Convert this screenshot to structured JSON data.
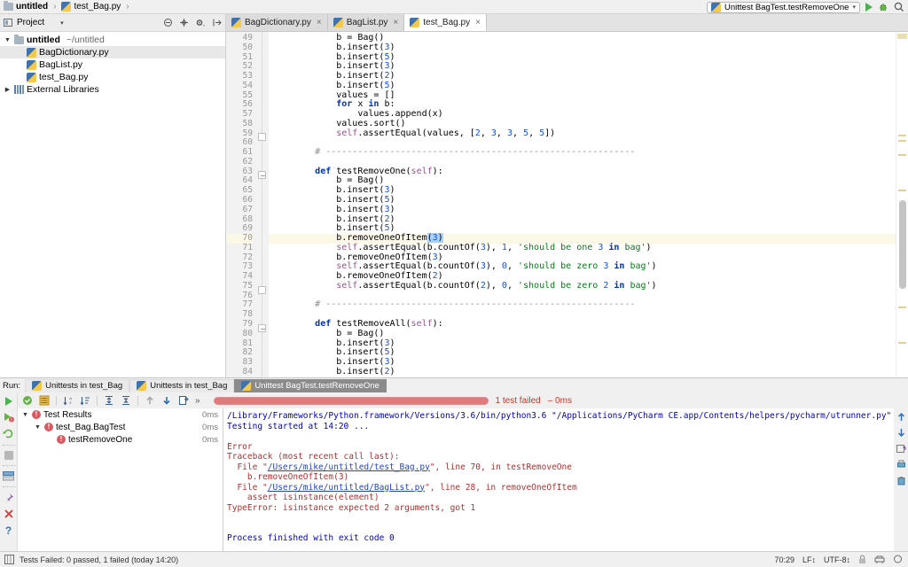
{
  "navbar": {
    "breadcrumb": [
      {
        "label": "untitled",
        "icon": "folder-icon",
        "bold": true
      },
      {
        "label": "test_Bag.py",
        "icon": "python-file-icon",
        "bold": false
      }
    ],
    "separator": "›",
    "run_configuration": "Unittest BagTest.testRemoveOne",
    "run_caret": "▾",
    "run_button": "run-icon",
    "debug_button": "debug-icon",
    "search_button": "search-icon"
  },
  "project_pane": {
    "title": "Project",
    "caret": "▾",
    "tools": [
      "collapse-all-icon",
      "locate-icon",
      "gear-icon",
      "hide-icon"
    ],
    "tree": [
      {
        "indent": 0,
        "twisty": "▼",
        "icon": "folder-icon",
        "label": "untitled",
        "bold": true,
        "sub": "~/untitled",
        "selected": false
      },
      {
        "indent": 1,
        "twisty": "",
        "icon": "python-file-icon",
        "label": "BagDictionary.py",
        "bold": false,
        "sub": "",
        "selected": true
      },
      {
        "indent": 1,
        "twisty": "",
        "icon": "python-file-icon",
        "label": "BagList.py",
        "bold": false,
        "sub": "",
        "selected": false
      },
      {
        "indent": 1,
        "twisty": "",
        "icon": "python-file-icon",
        "label": "test_Bag.py",
        "bold": false,
        "sub": "",
        "selected": false
      },
      {
        "indent": 0,
        "twisty": "▶",
        "icon": "library-icon",
        "label": "External Libraries",
        "bold": false,
        "sub": "",
        "selected": false
      }
    ]
  },
  "editor": {
    "tabs": [
      {
        "label": "BagDictionary.py",
        "icon": "python-file-icon",
        "close": "×",
        "active": false
      },
      {
        "label": "BagList.py",
        "icon": "python-file-icon",
        "close": "×",
        "active": false
      },
      {
        "label": "test_Bag.py",
        "icon": "python-file-icon",
        "close": "×",
        "active": true
      }
    ],
    "first_line_number": 49,
    "highlighted_line": 70,
    "lines": [
      {
        "n": 49,
        "text": "            b = Bag()"
      },
      {
        "n": 50,
        "text": "            b.insert(3)"
      },
      {
        "n": 51,
        "text": "            b.insert(5)"
      },
      {
        "n": 52,
        "text": "            b.insert(3)"
      },
      {
        "n": 53,
        "text": "            b.insert(2)"
      },
      {
        "n": 54,
        "text": "            b.insert(5)"
      },
      {
        "n": 55,
        "text": "            values = []"
      },
      {
        "n": 56,
        "text": "            for x in b:"
      },
      {
        "n": 57,
        "text": "                values.append(x)"
      },
      {
        "n": 58,
        "text": "            values.sort()"
      },
      {
        "n": 59,
        "text": "            self.assertEqual(values, [2, 3, 3, 5, 5])"
      },
      {
        "n": 60,
        "text": ""
      },
      {
        "n": 61,
        "text": "        # ----------------------------------------------------------"
      },
      {
        "n": 62,
        "text": ""
      },
      {
        "n": 63,
        "text": "        def testRemoveOne(self):"
      },
      {
        "n": 64,
        "text": "            b = Bag()"
      },
      {
        "n": 65,
        "text": "            b.insert(3)"
      },
      {
        "n": 66,
        "text": "            b.insert(5)"
      },
      {
        "n": 67,
        "text": "            b.insert(3)"
      },
      {
        "n": 68,
        "text": "            b.insert(2)"
      },
      {
        "n": 69,
        "text": "            b.insert(5)"
      },
      {
        "n": 70,
        "text": "            b.removeOneOfItem(3)"
      },
      {
        "n": 71,
        "text": "            self.assertEqual(b.countOf(3), 1, 'should be one 3 in bag')"
      },
      {
        "n": 72,
        "text": "            b.removeOneOfItem(3)"
      },
      {
        "n": 73,
        "text": "            self.assertEqual(b.countOf(3), 0, 'should be zero 3 in bag')"
      },
      {
        "n": 74,
        "text": "            b.removeOneOfItem(2)"
      },
      {
        "n": 75,
        "text": "            self.assertEqual(b.countOf(2), 0, 'should be zero 2 in bag')"
      },
      {
        "n": 76,
        "text": ""
      },
      {
        "n": 77,
        "text": "        # ----------------------------------------------------------"
      },
      {
        "n": 78,
        "text": ""
      },
      {
        "n": 79,
        "text": "        def testRemoveAll(self):"
      },
      {
        "n": 80,
        "text": "            b = Bag()"
      },
      {
        "n": 81,
        "text": "            b.insert(3)"
      },
      {
        "n": 82,
        "text": "            b.insert(5)"
      },
      {
        "n": 83,
        "text": "            b.insert(3)"
      },
      {
        "n": 84,
        "text": "            b.insert(2)"
      }
    ]
  },
  "run_panel": {
    "run_label": "Run:",
    "tabs": [
      {
        "label": "Unittests in test_Bag",
        "active": false
      },
      {
        "label": "Unittests in test_Bag",
        "active": false
      },
      {
        "label": "Unittest BagTest.testRemoveOne",
        "active": true
      }
    ],
    "left_rail": [
      "run-icon",
      "rerun-failed-icon",
      "rerun-icon",
      "stop-icon",
      "console-icon",
      "pin-icon",
      "close-icon",
      "help-icon"
    ],
    "toolbar": [
      "show-passed-icon",
      "expand-icon",
      "sort-alpha-icon",
      "sort-duration-icon",
      "expand-all-icon",
      "collapse-all-icon",
      "prev-icon",
      "next-icon",
      "export-icon",
      "more-icon"
    ],
    "toolbar_more": "»",
    "progress": {
      "status": "1 test failed",
      "duration": "– 0ms",
      "percent": 100,
      "color": "#c0392b"
    },
    "test_tree": [
      {
        "indent": 0,
        "twisty": "▼",
        "label": "Test Results",
        "time": "0ms"
      },
      {
        "indent": 1,
        "twisty": "▼",
        "label": "test_Bag.BagTest",
        "time": "0ms"
      },
      {
        "indent": 2,
        "twisty": "",
        "label": "testRemoveOne",
        "time": "0ms"
      }
    ],
    "console": [
      {
        "text": "/Library/Frameworks/Python.framework/Versions/3.6/bin/python3.6 \"/Applications/PyCharm CE.app/Contents/helpers/pycharm/utrunner.py\" /Users/mike/untitled/te",
        "style": "info"
      },
      {
        "text": "Testing started at 14:20 ...",
        "style": "info"
      },
      {
        "text": "",
        "style": "info"
      },
      {
        "text": "Error",
        "style": "error"
      },
      {
        "text": "Traceback (most recent call last):",
        "style": "error"
      },
      {
        "text": "  File \"/Users/mike/untitled/test_Bag.py\", line 70, in testRemoveOne",
        "style": "error",
        "link": "/Users/mike/untitled/test_Bag.py"
      },
      {
        "text": "    b.removeOneOfItem(3)",
        "style": "error"
      },
      {
        "text": "  File \"/Users/mike/untitled/BagList.py\", line 28, in removeOneOfItem",
        "style": "error",
        "link": "/Users/mike/untitled/BagList.py"
      },
      {
        "text": "    assert isinstance(element)",
        "style": "error"
      },
      {
        "text": "TypeError: isinstance expected 2 arguments, got 1",
        "style": "error"
      },
      {
        "text": "",
        "style": "info"
      },
      {
        "text": "",
        "style": "info"
      },
      {
        "text": "Process finished with exit code 0",
        "style": "info"
      }
    ],
    "console_rail": [
      "scroll-up-icon",
      "scroll-down-icon",
      "soft-wrap-icon",
      "print-icon",
      "clear-all-icon"
    ]
  },
  "statusbar": {
    "icon": "event-log-icon",
    "message": "Tests Failed: 0 passed, 1 failed (today 14:20)",
    "caret_position": "70:29",
    "line_separator": "LF↕",
    "encoding": "UTF-8↕",
    "lock_icon": "lock-icon",
    "branch_icon": "vcs-icon",
    "inspect_icon": "inspection-icon"
  }
}
